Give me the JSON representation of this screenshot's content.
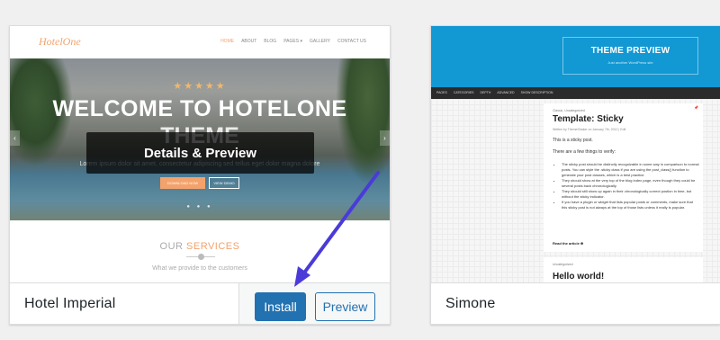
{
  "colors": {
    "wp_primary": "#2271b1",
    "hotel_accent": "#f3a26c",
    "simone_blue": "#1298d3",
    "annotation_arrow": "#4a3bd8"
  },
  "themes": [
    {
      "name": "Hotel Imperial",
      "overlay_label": "Details & Preview",
      "install_label": "Install",
      "preview_label": "Preview",
      "screenshot": {
        "logo": "HotelOne",
        "menu": [
          "HOME",
          "ABOUT",
          "BLOG",
          "PAGES ▾",
          "GALLERY",
          "CONTACT US"
        ],
        "stars": "★★★★★",
        "hero_title": "WELCOME TO HOTELONE",
        "hero_title_2": "THEME",
        "hero_sub": "Lorem ipsum dolor sit amet, consectetur adipiscing sed tellus eget dolor magna dolore",
        "btn_download": "DOWNLOAD NOW",
        "btn_view": "VIEW DEMO",
        "arrow_left": "‹",
        "arrow_right": "›",
        "dots": "● ● ●",
        "services_our": "OUR",
        "services_word": "SERVICES",
        "services_tagline": "What we provide to the customers"
      }
    },
    {
      "name": "Simone",
      "screenshot": {
        "header_title": "THEME PREVIEW",
        "header_desc": "Just another WordPress site",
        "nav": [
          "PAGES",
          "CATEGORIES",
          "DEPTH",
          "ADVANCED",
          "SHOW DESCRIPTION"
        ],
        "post_category": "Classic, Uncategorized",
        "pin": "📌",
        "post_title": "Template: Sticky",
        "post_meta": "Written by ThemeShaker on January 7th, 2012 | Edit",
        "p1": "This is a sticky post.",
        "p2": "There are a few things to verify:",
        "list": [
          "The sticky post should be distinctly recognizable in some way in comparison to normal posts. You can style the .sticky class if you are using the post_class() function to generate your post classes, which is a best practice.",
          "They should show at the very top of the blog index page, even though they could be several posts back chronologically.",
          "They should still show up again in their chronologically correct postion in time, but without the sticky indicator.",
          "If you have a plugin or widget that lists popular posts or comments, make sure that this sticky post is not always at the top of those lists unless it really is popular."
        ],
        "read_more": "Read the article ⊕",
        "post2_category": "Uncategorized",
        "post2_title": "Hello world!"
      }
    }
  ]
}
